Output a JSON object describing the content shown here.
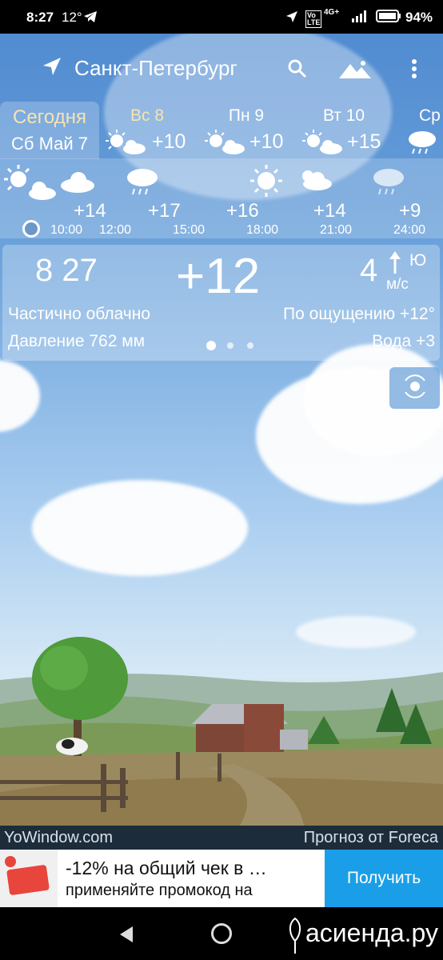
{
  "status": {
    "time": "8:27",
    "temp": "12°",
    "battery": "94%"
  },
  "header": {
    "city": "Санкт-Петербург"
  },
  "days": [
    {
      "name": "Сегодня",
      "date": "Сб Май 7"
    },
    {
      "name": "Вс 8",
      "temp": "+10"
    },
    {
      "name": "Пн 9",
      "temp": "+10"
    },
    {
      "name": "Вт 10",
      "temp": "+15"
    },
    {
      "name": "Ср",
      "temp": ""
    }
  ],
  "hours": [
    {
      "temp": "+14",
      "time": "10:00"
    },
    {
      "temp": "+17",
      "time": "12:00"
    },
    {
      "temp": "+16",
      "time": "15:00"
    },
    {
      "temp": "+14",
      "time": "18:00"
    },
    {
      "temp": "+9",
      "time": "21:00"
    },
    {
      "temp": "",
      "time": "24:00"
    }
  ],
  "current": {
    "time": "8 27",
    "temp": "+12",
    "wind": "4",
    "wind_dir": "Ю",
    "wind_unit": "м/с",
    "condition": "Частично облачно",
    "feels": "По ощущению +12°",
    "pressure": "Давление 762 мм",
    "water": "Вода +3"
  },
  "footer": {
    "left": "YoWindow.com",
    "right": "Прогноз от Foreca"
  },
  "ad": {
    "line1": "-12% на общий чек в …",
    "line2": "применяйте промокод на",
    "button": "Получить"
  },
  "watermark": "асиенда.ру"
}
